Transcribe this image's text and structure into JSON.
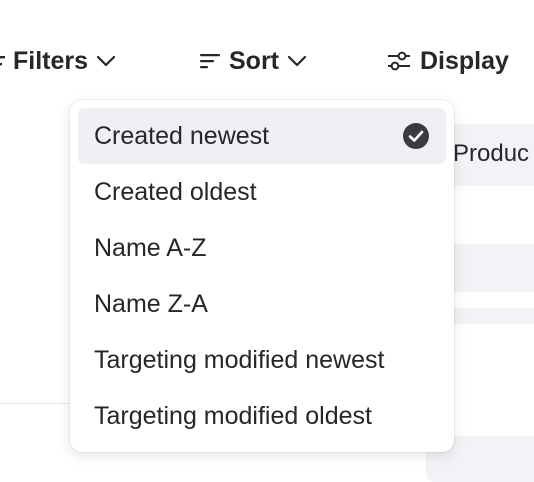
{
  "toolbar": {
    "filters_label": "Filters",
    "sort_label": "Sort",
    "display_label": "Display"
  },
  "background": {
    "tab_label": "Produc"
  },
  "sort_menu": {
    "options": [
      {
        "label": "Created newest",
        "selected": true
      },
      {
        "label": "Created oldest",
        "selected": false
      },
      {
        "label": "Name A-Z",
        "selected": false
      },
      {
        "label": "Name Z-A",
        "selected": false
      },
      {
        "label": "Targeting modified newest",
        "selected": false
      },
      {
        "label": "Targeting modified oldest",
        "selected": false
      }
    ]
  },
  "icons": {
    "filters": "filter-icon",
    "sort": "sort-lines-icon",
    "display": "sliders-icon",
    "chevron": "chevron-down-icon",
    "selected": "check-circle-icon"
  },
  "colors": {
    "text": "#26262b",
    "selected_bg": "#eef0f4",
    "check_fill": "#3a3b40"
  }
}
